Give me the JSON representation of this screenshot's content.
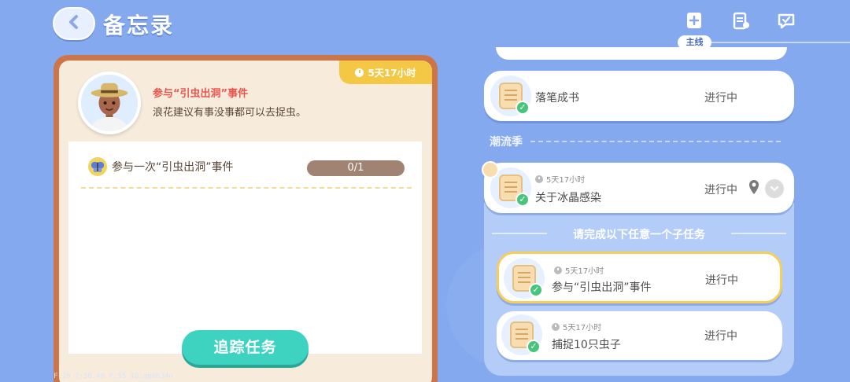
{
  "header": {
    "title": "备忘录",
    "main_tab_label": "主线",
    "icons": [
      "back-arrow-icon",
      "add-quest-icon",
      "clipboard-icon",
      "chat-check-icon"
    ]
  },
  "detail": {
    "timer": "5天17小时",
    "quest_name": "参与“引虫出洞”事件",
    "description": "浪花建议有事没事都可以去捉虫。",
    "task": {
      "text": "参与一次“引虫出洞”事件",
      "progress": "0/1",
      "progress_value": 0
    },
    "track_button": "追踪任务",
    "debug": "F:28   T:38.40   P:55   ID:qp8h34n"
  },
  "list": {
    "quest_1": {
      "title": "落笔成书",
      "status": "进行中"
    },
    "section_label": "潮流季",
    "quest_2": {
      "timer": "5天17小时",
      "title": "关于冰晶感染",
      "status": "进行中"
    },
    "subtask_hint": "请完成以下任意一个子任务",
    "subtask_1": {
      "timer": "5天17小时",
      "title": "参与“引虫出洞”事件",
      "status": "进行中"
    },
    "subtask_2": {
      "timer": "5天17小时",
      "title": "捕捉10只虫子",
      "status": "进行中"
    }
  },
  "colors": {
    "background": "#84a9ee",
    "card_border": "#cc7548",
    "timer_tab": "#f4c844",
    "accent_red": "#e8574f",
    "track_button": "#3ed3c1",
    "selected_outline": "#f6cf5a"
  }
}
